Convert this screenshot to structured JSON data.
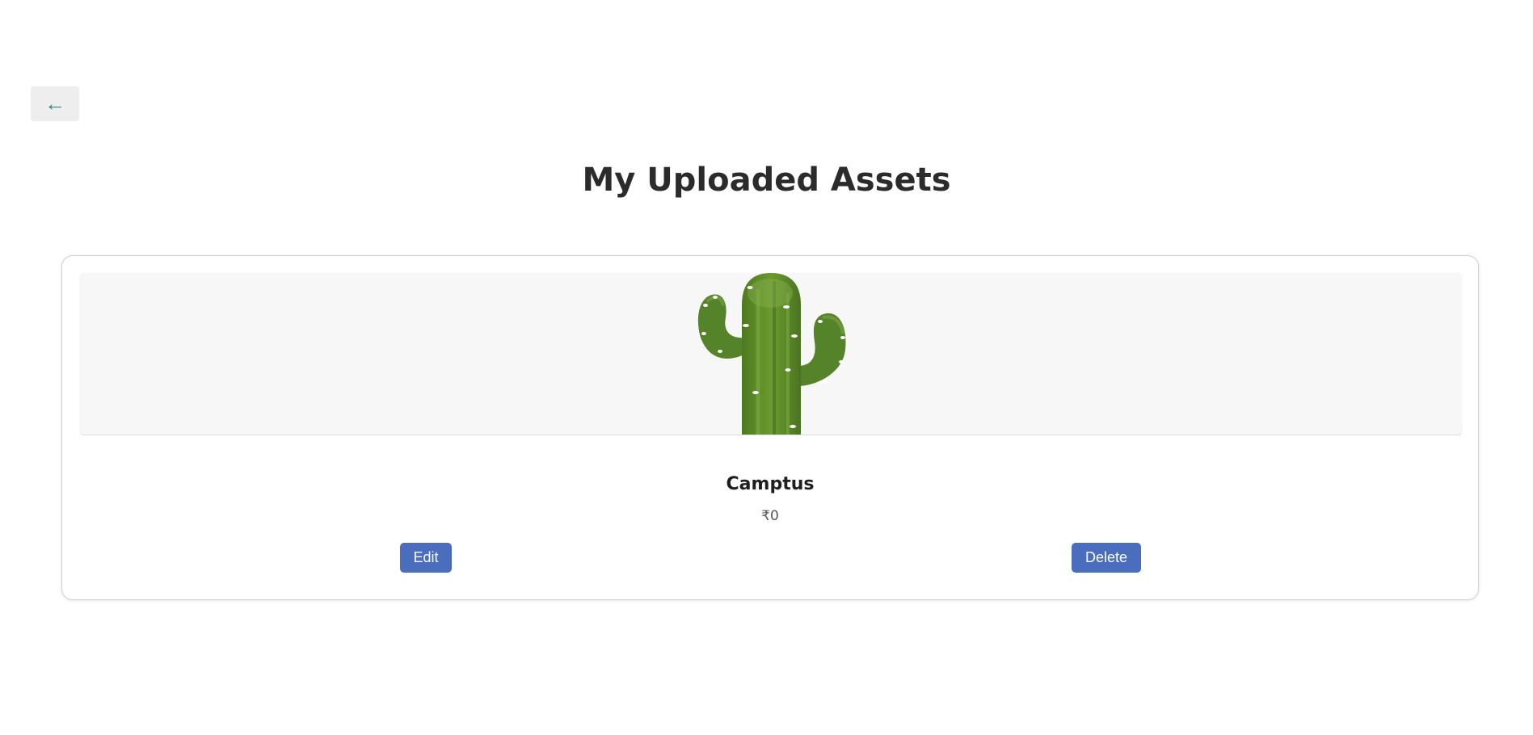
{
  "header": {
    "back_label": "←",
    "title": "My Uploaded Assets"
  },
  "assets": [
    {
      "name": "Camptus",
      "price": "₹0",
      "image_icon": "cactus-icon",
      "edit_label": "Edit",
      "delete_label": "Delete"
    }
  ],
  "colors": {
    "button": "#4a6dbd",
    "back_arrow": "#2a8c8c",
    "title": "#2b2b2b",
    "image_bg": "#f7f7f7"
  }
}
